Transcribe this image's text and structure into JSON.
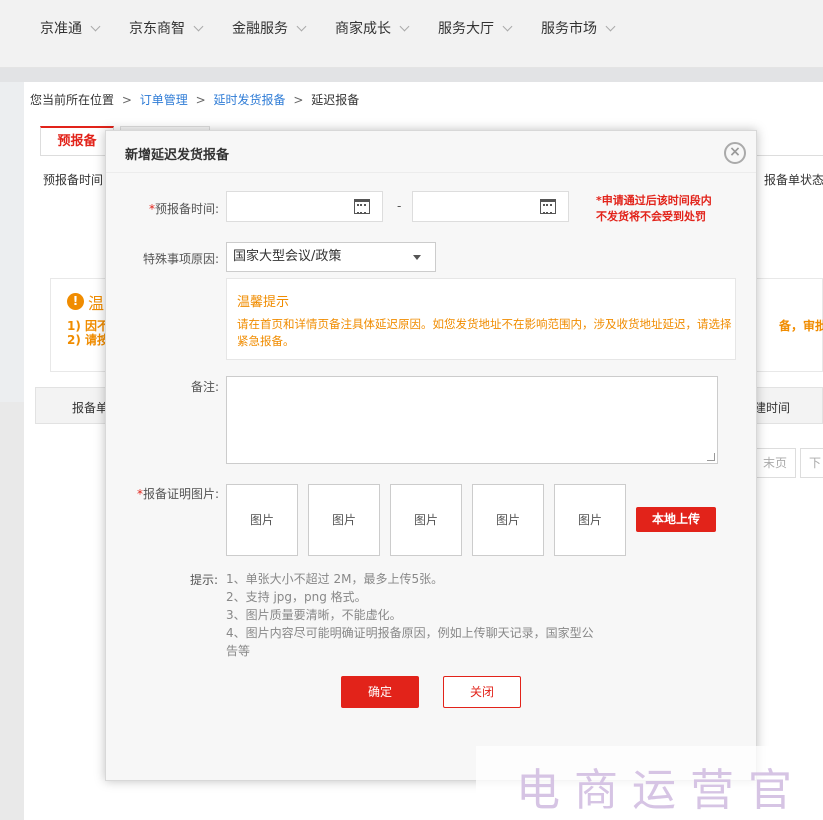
{
  "topnav": {
    "items": [
      {
        "label": "京准通"
      },
      {
        "label": "京东商智"
      },
      {
        "label": "金融服务"
      },
      {
        "label": "商家成长"
      },
      {
        "label": "服务大厅"
      },
      {
        "label": "服务市场"
      }
    ]
  },
  "breadcrumb": {
    "prefix": "您当前所在位置",
    "sep": ">",
    "items": [
      "订单管理",
      "延时发货报备",
      "延迟报备"
    ]
  },
  "tabs": {
    "active_label": "预报备"
  },
  "filters": {
    "left_label": "预报备时间",
    "right_label": "报备单状态"
  },
  "warning": {
    "icon": "!",
    "title": "温",
    "line1": "1) 因不",
    "line2": "2) 请按",
    "right_text": "备，审批通过"
  },
  "table": {
    "col1": "报备单",
    "col2": "建时间"
  },
  "pagination": {
    "last_label": "末页",
    "next_label": "下"
  },
  "modal": {
    "title": "新增延迟发货报备",
    "close_icon": "×",
    "date": {
      "required": "*",
      "label": "预报备时间:",
      "dash": "-",
      "warn_line1": "*申请通过后该时间段内",
      "warn_line2": "不发货将不会受到处罚"
    },
    "reason": {
      "label": "特殊事项原因:",
      "selected": "国家大型会议/政策"
    },
    "tip": {
      "title": "温馨提示",
      "text": "请在首页和详情页备注具体延迟原因。如您发货地址不在影响范围内，涉及收货地址延迟，请选择紧急报备。"
    },
    "remark": {
      "label": "备注:"
    },
    "images": {
      "required": "*",
      "label": "报备证明图片:",
      "slots": [
        "图片",
        "图片",
        "图片",
        "图片",
        "图片"
      ],
      "upload_label": "本地上传"
    },
    "hints": {
      "label": "提示:",
      "lines": [
        "1、单张大小不超过 2M，最多上传5张。",
        "2、支持 jpg，png 格式。",
        "3、图片质量要清晰，不能虚化。",
        "4、图片内容尽可能明确证明报备原因，例如上传聊天记录，国家型公告等"
      ]
    },
    "confirm_label": "确定",
    "close_label": "关闭"
  },
  "watermark": {
    "text": "电商运营官"
  }
}
